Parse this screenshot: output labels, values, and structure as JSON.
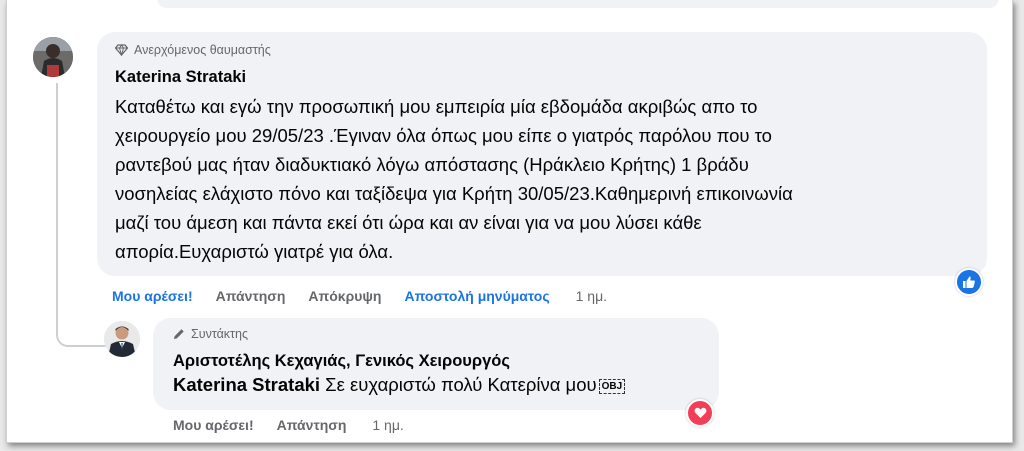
{
  "comment": {
    "badge": "Ανερχόμενος θαυμαστής",
    "author": "Katerina Strataki",
    "body_lines": [
      "Καταθέτω και εγώ την προσωπική μου εμπειρία μία εβδομάδα ακριβώς απο το",
      "χειρουργείο μου 29/05/23 .Έγιναν όλα όπως μου είπε ο γιατρός παρόλου που το",
      "ραντεβού μας ήταν διαδυκτιακό λόγω απόστασης (Ηράκλειο Κρήτης) 1 βράδυ",
      "νοσηλείας ελάχιστο πόνο και ταξίδεψα για Κρήτη 30/05/23.Καθημερινή επικοινωνία",
      "μαζί του άμεση και πάντα εκεί ότι ώρα και αν είναι για να μου λύσει κάθε",
      "απορία.Ευχαριστώ γιατρέ για όλα."
    ],
    "actions": {
      "like": "Μου αρέσει!",
      "reply": "Απάντηση",
      "hide": "Απόκρυψη",
      "message": "Αποστολή μηνύματος",
      "time": "1 ημ."
    },
    "reaction_icon": "thumbs-up-icon"
  },
  "reply": {
    "badge": "Συντάκτης",
    "author": "Αριστοτέλης Κεχαγιάς, Γενικός Χειρουργός",
    "mention": "Katerina Strataki",
    "text": " Σε ευχαριστώ πολύ Κατερίνα μου",
    "obj": "OBJ",
    "actions": {
      "like": "Μου αρέσει!",
      "reply": "Απάντηση",
      "time": "1 ημ."
    },
    "reaction_icon": "heart-icon"
  },
  "colors": {
    "bubble": "#f0f2f5",
    "link_blue": "#1b74e4",
    "muted": "#65676b",
    "love": "#f33e58"
  }
}
